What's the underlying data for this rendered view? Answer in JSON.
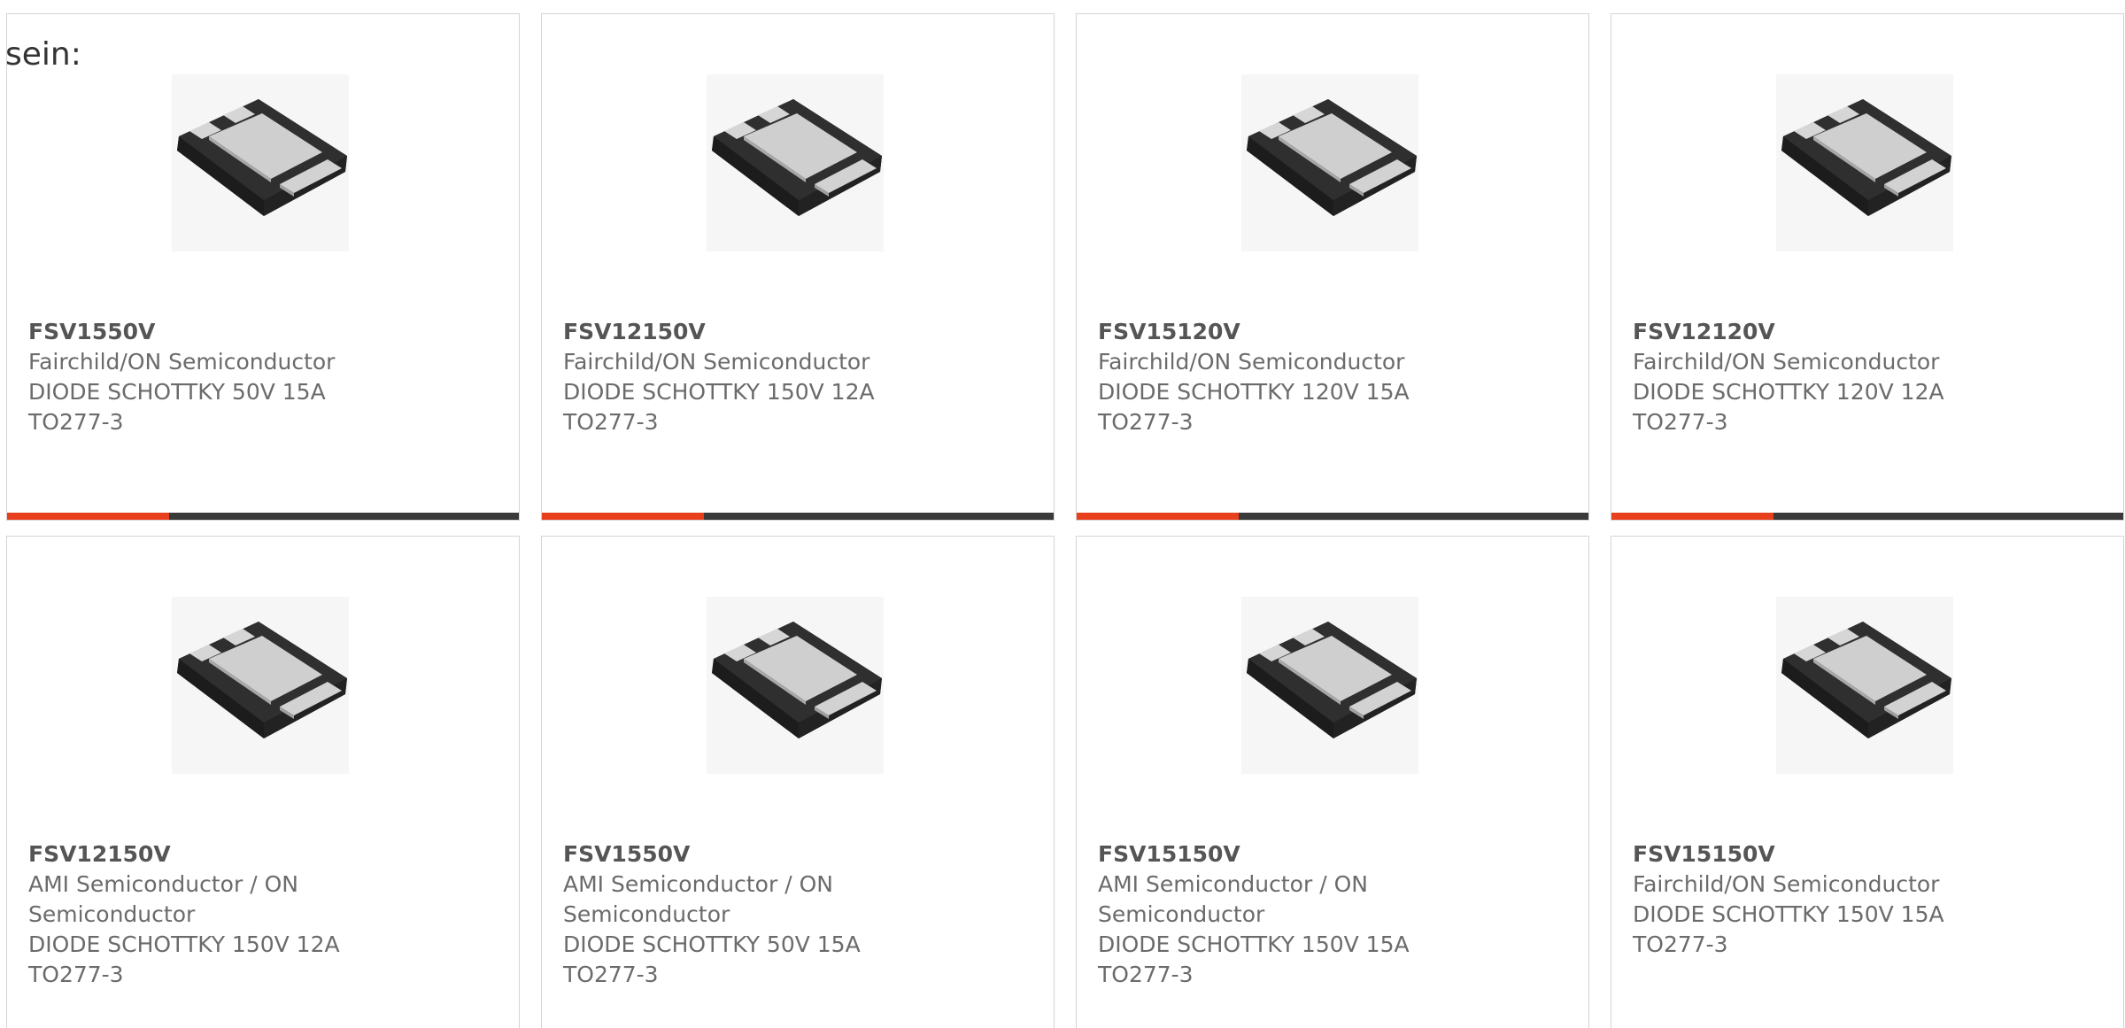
{
  "intro_text": "sein:",
  "product_image_icon": "schottky-diode-to277-package-icon",
  "colors": {
    "accent": "#e8401c",
    "bar_track": "#3a3a3a",
    "card_border": "#d4d4d4",
    "text": "#6b6b6b"
  },
  "products": [
    {
      "part": "FSV1550V",
      "manufacturer": "Fairchild/ON Semiconductor",
      "description": "DIODE SCHOTTKY 50V 15A",
      "package": "TO277-3"
    },
    {
      "part": "FSV12150V",
      "manufacturer": "Fairchild/ON Semiconductor",
      "description": "DIODE SCHOTTKY 150V 12A",
      "package": "TO277-3"
    },
    {
      "part": "FSV15120V",
      "manufacturer": "Fairchild/ON Semiconductor",
      "description": "DIODE SCHOTTKY 120V 15A",
      "package": "TO277-3"
    },
    {
      "part": "FSV12120V",
      "manufacturer": "Fairchild/ON Semiconductor",
      "description": "DIODE SCHOTTKY 120V 12A",
      "package": "TO277-3"
    },
    {
      "part": "FSV12150V",
      "manufacturer": "AMI Semiconductor / ON Semiconductor",
      "description": "DIODE SCHOTTKY 150V 12A",
      "package": "TO277-3"
    },
    {
      "part": "FSV1550V",
      "manufacturer": "AMI Semiconductor / ON Semiconductor",
      "description": "DIODE SCHOTTKY 50V 15A",
      "package": "TO277-3"
    },
    {
      "part": "FSV15150V",
      "manufacturer": "AMI Semiconductor / ON Semiconductor",
      "description": "DIODE SCHOTTKY 150V 15A",
      "package": "TO277-3"
    },
    {
      "part": "FSV15150V",
      "manufacturer": "Fairchild/ON Semiconductor",
      "description": "DIODE SCHOTTKY 150V 15A",
      "package": "TO277-3"
    }
  ]
}
